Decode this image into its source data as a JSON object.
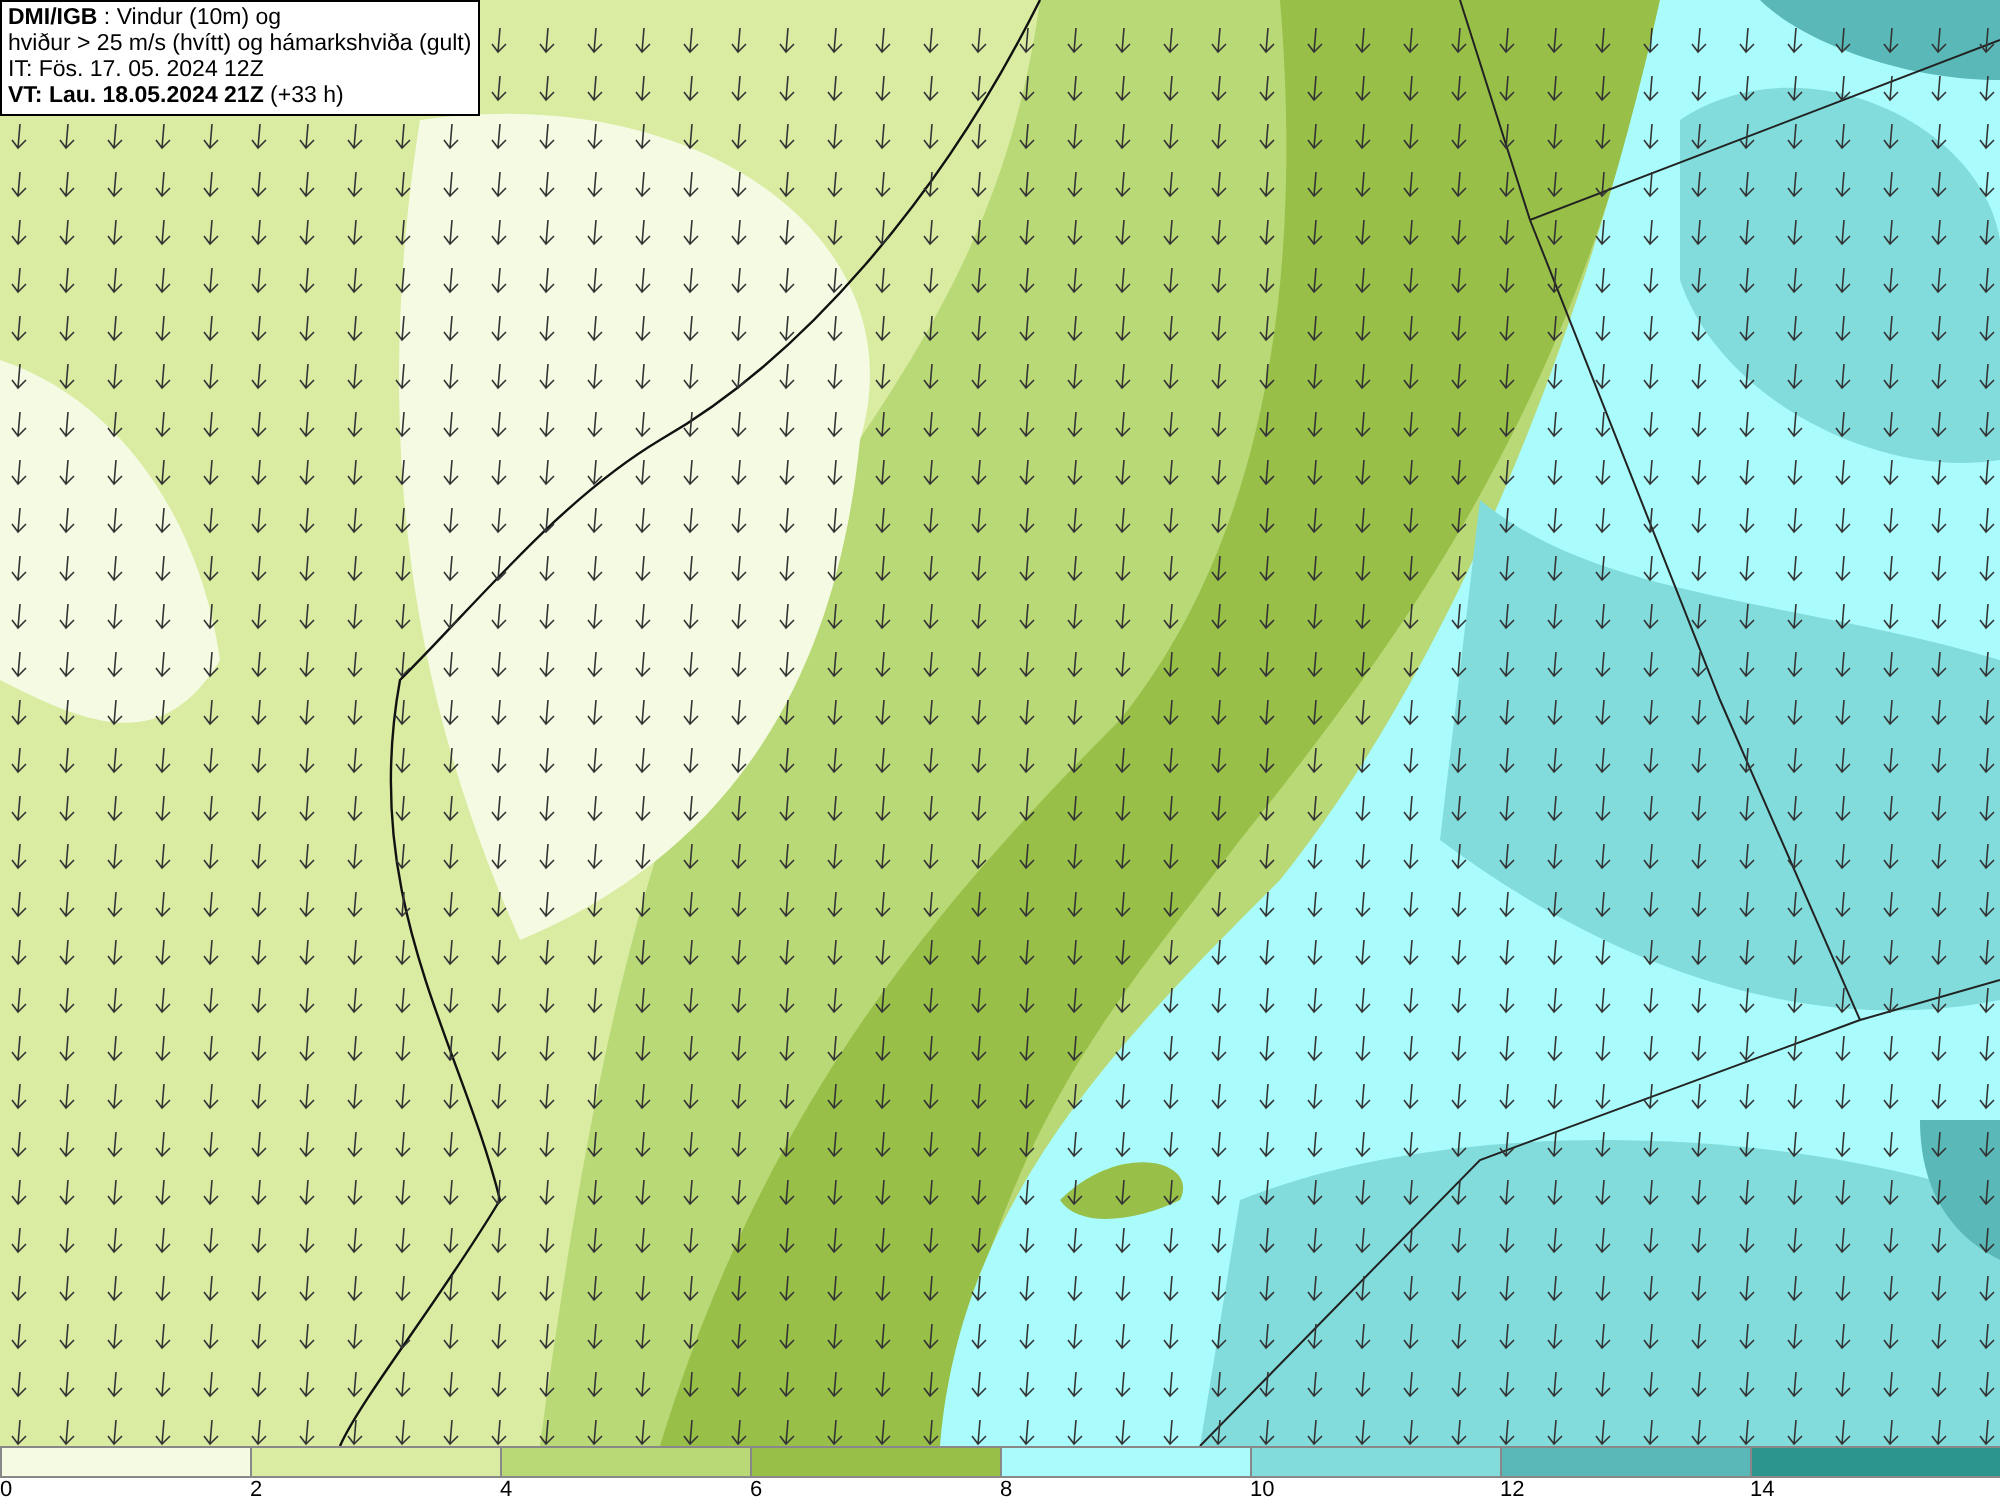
{
  "header": {
    "lines": [
      "**DMI/IGB** : Vindur (10m) og",
      "hviður > 25 m/s (hvítt) og hámarkshviða (gult)",
      "IT: Fös. 17. 05. 2024 12Z",
      "**VT: Lau. 18.05.2024 21Z** (+33 h)"
    ]
  },
  "legend": {
    "segments": [
      {
        "color": "#f5fbe3"
      },
      {
        "color": "#d9eca2"
      },
      {
        "color": "#b9d876"
      },
      {
        "color": "#98bf48"
      },
      {
        "color": "#aafcfc"
      },
      {
        "color": "#82dcdc"
      },
      {
        "color": "#5ab8b8"
      },
      {
        "color": "#2b958e"
      }
    ],
    "labels": [
      "0",
      "2",
      "4",
      "6",
      "8",
      "10",
      "12",
      "14"
    ]
  }
}
